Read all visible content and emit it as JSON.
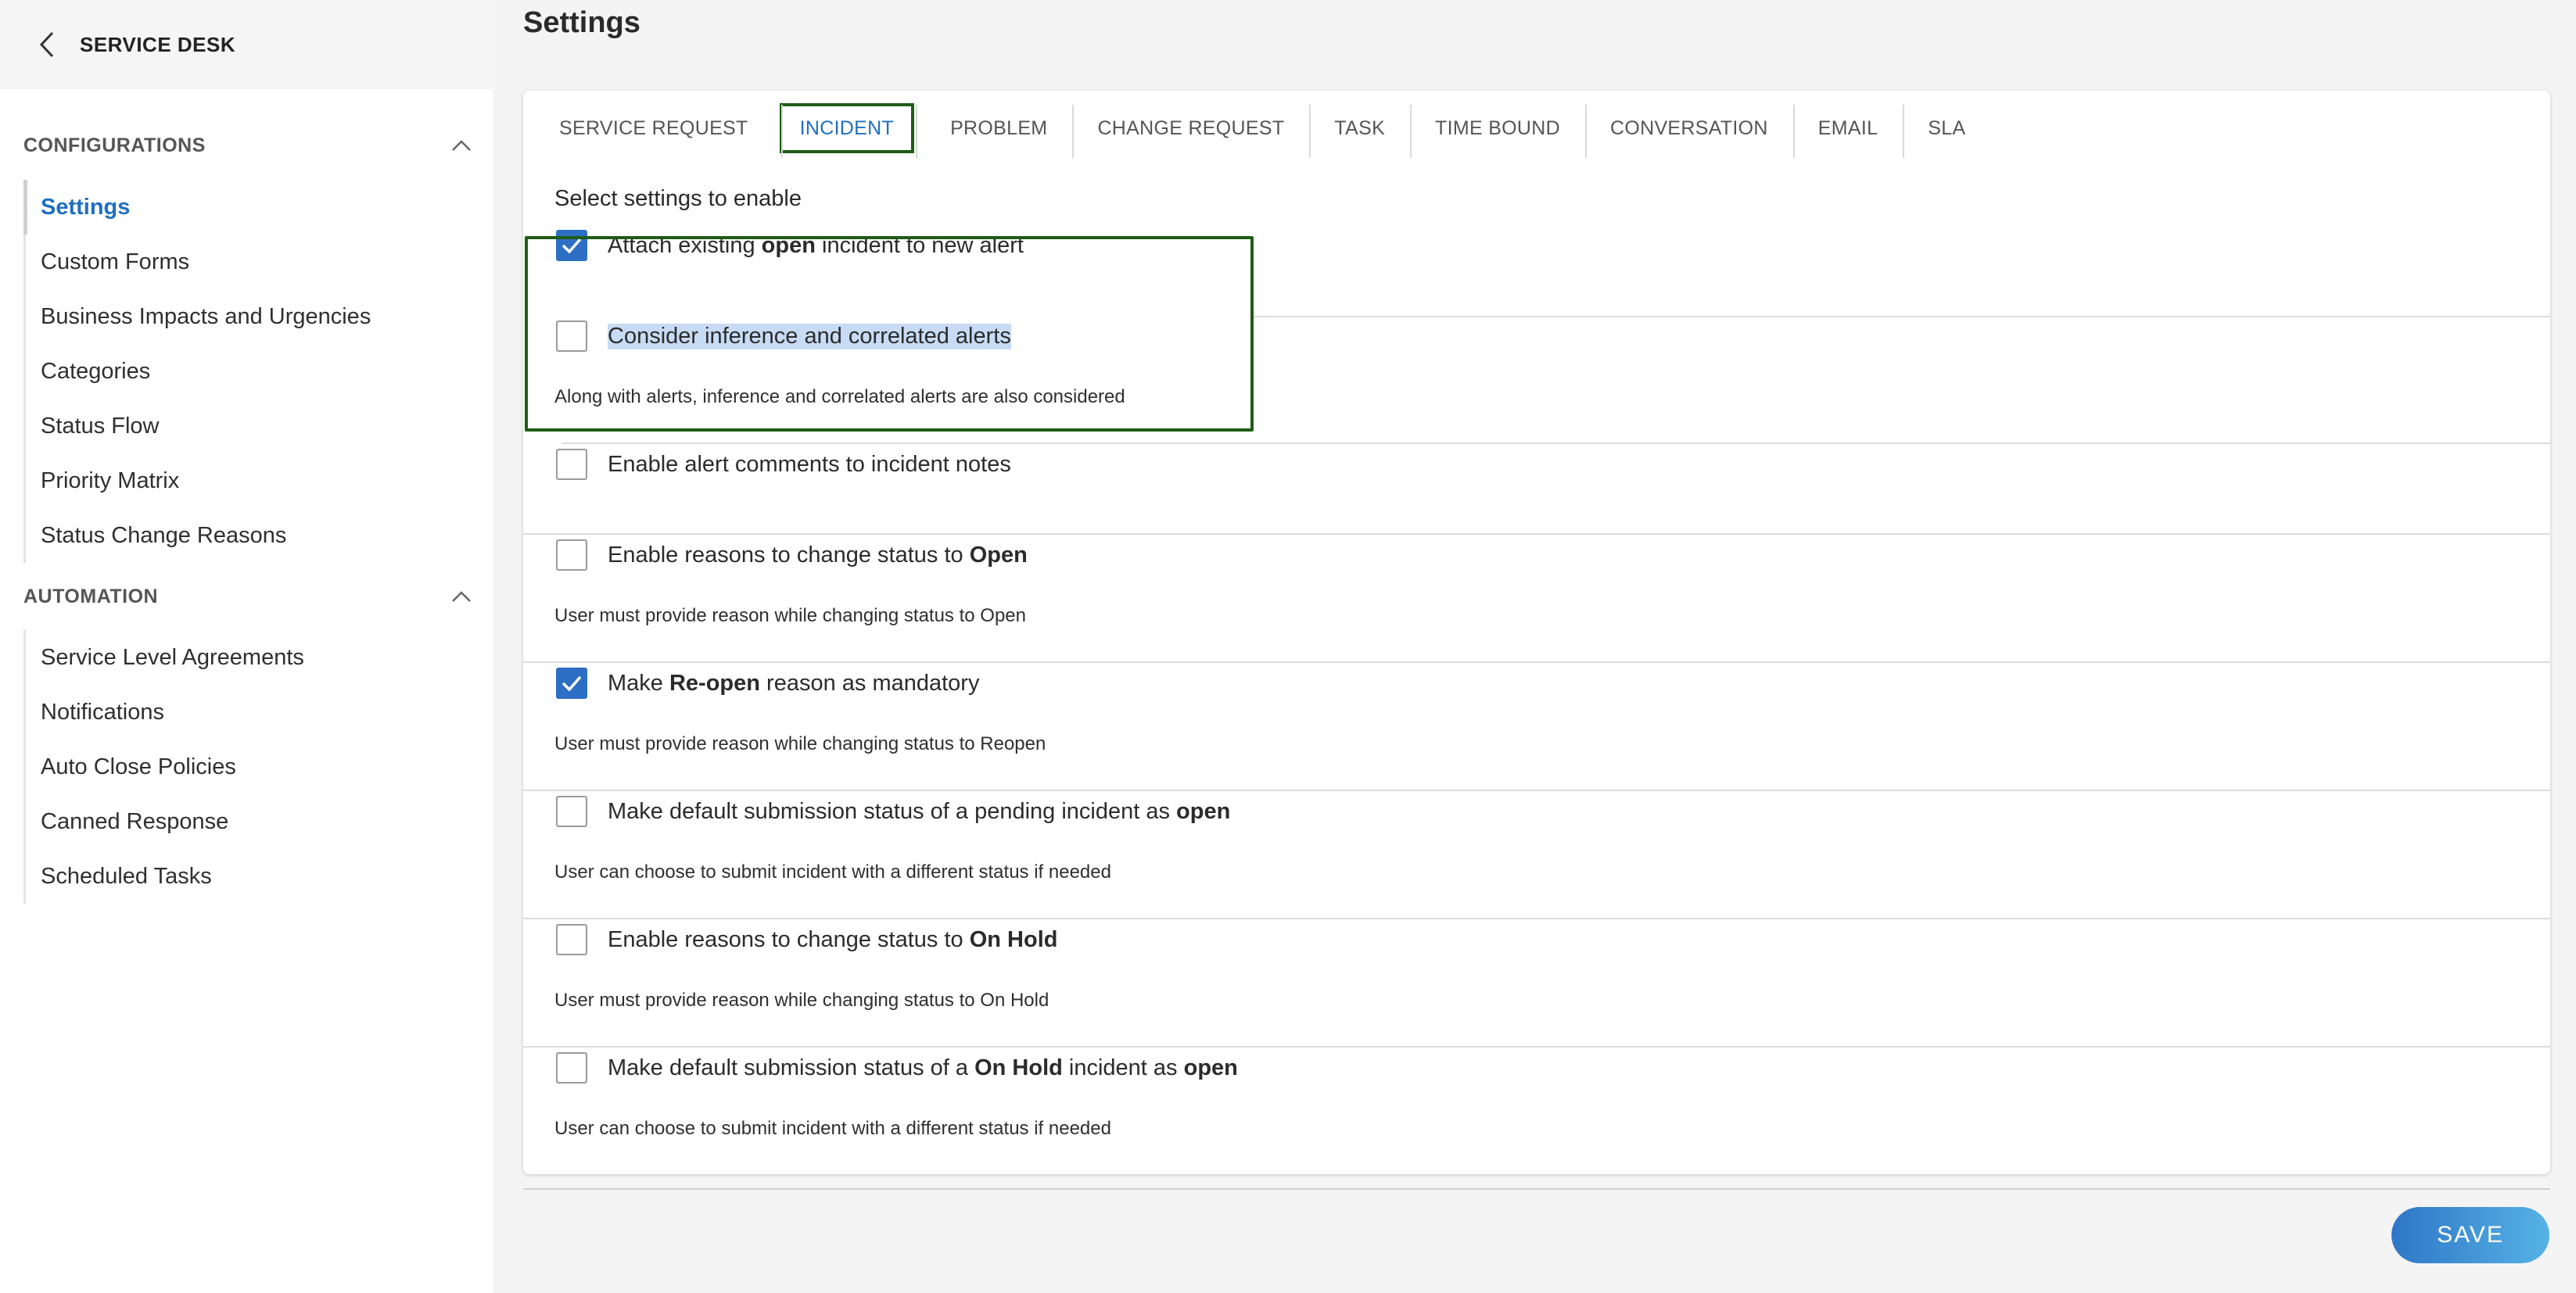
{
  "sidebar": {
    "title": "SERVICE DESK",
    "sections": [
      {
        "label": "CONFIGURATIONS",
        "items": [
          {
            "label": "Settings",
            "active": true
          },
          {
            "label": "Custom Forms"
          },
          {
            "label": "Business Impacts and Urgencies"
          },
          {
            "label": "Categories"
          },
          {
            "label": "Status Flow"
          },
          {
            "label": "Priority Matrix"
          },
          {
            "label": "Status Change Reasons"
          }
        ]
      },
      {
        "label": "AUTOMATION",
        "items": [
          {
            "label": "Service Level Agreements"
          },
          {
            "label": "Notifications"
          },
          {
            "label": "Auto Close Policies"
          },
          {
            "label": "Canned Response"
          },
          {
            "label": "Scheduled Tasks"
          }
        ]
      }
    ]
  },
  "page": {
    "title": "Settings",
    "select_label": "Select settings to enable",
    "save_label": "SAVE"
  },
  "tabs": [
    {
      "label": "SERVICE REQUEST"
    },
    {
      "label": "INCIDENT",
      "active": true
    },
    {
      "label": "PROBLEM"
    },
    {
      "label": "CHANGE REQUEST"
    },
    {
      "label": "TASK"
    },
    {
      "label": "TIME BOUND"
    },
    {
      "label": "CONVERSATION"
    },
    {
      "label": "EMAIL"
    },
    {
      "label": "SLA"
    }
  ],
  "settings": [
    {
      "checked": true,
      "label_parts": [
        {
          "text": "Attach existing "
        },
        {
          "text": "open",
          "bold": true
        },
        {
          "text": " incident to new alert"
        }
      ],
      "description": ""
    },
    {
      "checked": false,
      "highlighted": true,
      "label_parts": [
        {
          "text": "Consider inference and correlated alerts"
        }
      ],
      "description": "Along with alerts, inference and correlated alerts are also considered"
    },
    {
      "checked": false,
      "label_parts": [
        {
          "text": "Enable alert comments to incident notes"
        }
      ],
      "description": ""
    },
    {
      "checked": false,
      "label_parts": [
        {
          "text": "Enable reasons to change status to "
        },
        {
          "text": "Open",
          "bold": true
        }
      ],
      "description": "User must provide reason while changing status to Open"
    },
    {
      "checked": true,
      "label_parts": [
        {
          "text": "Make "
        },
        {
          "text": "Re-open",
          "bold": true
        },
        {
          "text": " reason as mandatory"
        }
      ],
      "description": "User must provide reason while changing status to Reopen"
    },
    {
      "checked": false,
      "label_parts": [
        {
          "text": "Make default submission status of a pending incident as "
        },
        {
          "text": "open",
          "bold": true
        }
      ],
      "description": "User can choose to submit incident with a different status if needed"
    },
    {
      "checked": false,
      "label_parts": [
        {
          "text": "Enable reasons to change status to "
        },
        {
          "text": "On Hold",
          "bold": true
        }
      ],
      "description": "User must provide reason while changing status to On Hold"
    },
    {
      "checked": false,
      "label_parts": [
        {
          "text": "Make default submission status of a "
        },
        {
          "text": "On Hold",
          "bold": true
        },
        {
          "text": " incident as "
        },
        {
          "text": "open",
          "bold": true
        }
      ],
      "description": "User can choose to submit incident with a different status if needed"
    }
  ],
  "icons": {
    "back": "chevron-left-icon",
    "collapse": "chevron-up-icon",
    "check": "checkmark-icon"
  },
  "colors": {
    "accent": "#1f6fc0",
    "checkbox_checked": "#2d6fc4",
    "highlight_border": "#1f5c16",
    "text_highlight": "#c7dcf4"
  }
}
